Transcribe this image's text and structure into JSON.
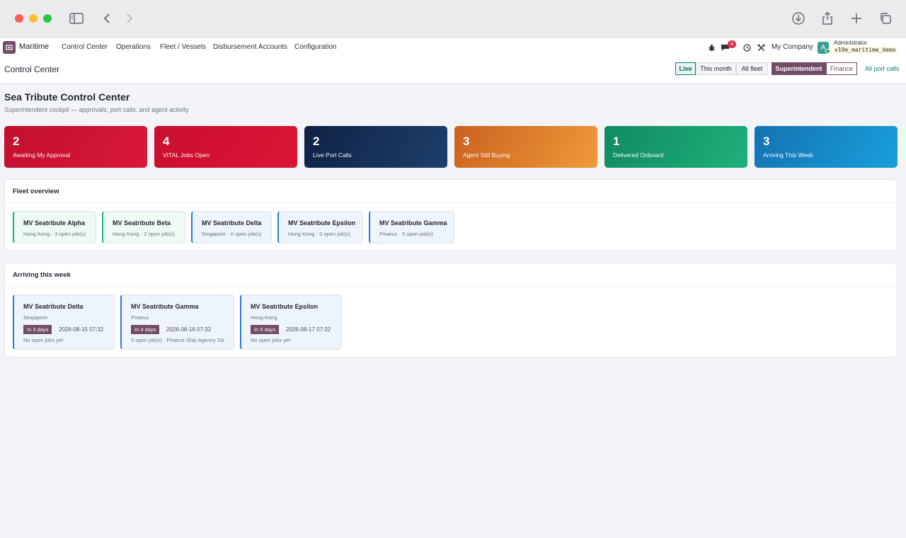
{
  "app": {
    "brand": "Maritime",
    "menus": [
      "Control Center",
      "Operations",
      "Fleet / Vessels",
      "Disbursement Accounts",
      "Configuration"
    ],
    "message_count": "4",
    "company": "My Company",
    "user_initial": "A",
    "user_name": "Administrator",
    "db_name": "v19e_maritime_demo"
  },
  "control_panel": {
    "breadcrumb": "Control Center",
    "period_filters": [
      "Live",
      "This month",
      "All fleet"
    ],
    "active_period": "Live",
    "roles": [
      "Superintendent",
      "Finance"
    ],
    "active_role": "Superintendent",
    "link": "All port calls"
  },
  "dashboard": {
    "title": "Sea Tribute Control Center",
    "subtitle": "Superintendent cockpit — approvals, port calls, and agent activity",
    "kpis": [
      {
        "value": "2",
        "label": "Awaiting My Approval",
        "color": "#c8102e"
      },
      {
        "value": "4",
        "label": "VITAL Jobs Open",
        "color": "#d0102f"
      },
      {
        "value": "2",
        "label": "Live Port Calls",
        "color": "#14294d"
      },
      {
        "value": "3",
        "label": "Agent Still Buying",
        "color": "#dd7a2a"
      },
      {
        "value": "1",
        "label": "Delivered Onboard",
        "color": "#159a6c"
      },
      {
        "value": "3",
        "label": "Arriving This Week",
        "color": "#1586c7"
      }
    ],
    "fleet": {
      "title": "Fleet overview",
      "vessels": [
        {
          "name": "MV Seatribute Alpha",
          "meta": "Hong Kong · 3 open job(s)",
          "status": "green"
        },
        {
          "name": "MV Seatribute Beta",
          "meta": "Hong Kong · 2 open job(s)",
          "status": "green"
        },
        {
          "name": "MV Seatribute Delta",
          "meta": "Singapore · 0 open job(s)",
          "status": "blue"
        },
        {
          "name": "MV Seatribute Epsilon",
          "meta": "Hong Kong · 0 open job(s)",
          "status": "blue"
        },
        {
          "name": "MV Seatribute Gamma",
          "meta": "Piraeus · 5 open job(s)",
          "status": "blue"
        }
      ]
    },
    "arrivals": {
      "title": "Arriving this week",
      "items": [
        {
          "name": "MV Seatribute Delta",
          "port": "Singapore",
          "eta_chip": "In 3 days",
          "eta": "2026-08-15 07:32",
          "jobs": "No open jobs yet"
        },
        {
          "name": "MV Seatribute Gamma",
          "port": "Piraeus",
          "eta_chip": "In 4 days",
          "eta": "2026-08-16 07:32",
          "jobs": "5 open job(s) · Piraeus Ship Agency SA"
        },
        {
          "name": "MV Seatribute Epsilon",
          "port": "Hong Kong",
          "eta_chip": "In 5 days",
          "eta": "2026-08-17 07:32",
          "jobs": "No open jobs yet"
        }
      ]
    }
  }
}
